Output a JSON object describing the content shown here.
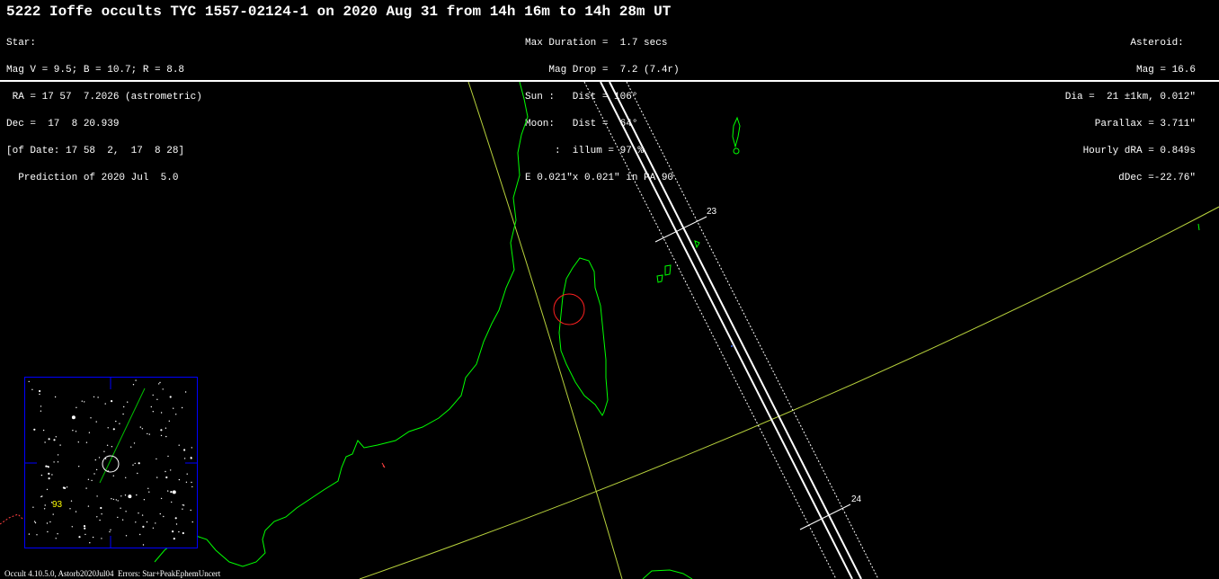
{
  "header": {
    "title": "5222 Ioffe occults TYC 1557-02124-1 on 2020 Aug 31 from 14h 16m to 14h 28m UT"
  },
  "star": {
    "lines": [
      "Star:",
      "Mag V = 9.5; B = 10.7; R = 8.8",
      " RA = 17 57  7.2026 (astrometric)",
      "Dec =  17  8 20.939",
      "[of Date: 17 58  2,  17  8 28]",
      "  Prediction of 2020 Jul  5.0"
    ]
  },
  "event": {
    "lines": [
      "Max Duration =  1.7 secs",
      "    Mag Drop =  7.2 (7.4r)",
      "Sun :   Dist = 106°",
      "Moon:   Dist =  64°",
      "     :  illum = 97 %",
      "E 0.021\"x 0.021\" in PA 90"
    ]
  },
  "asteroid": {
    "lines": [
      "Asteroid:  ",
      "Mag = 16.6",
      "Dia =  21 ±1km, 0.012\"",
      "Parallax = 3.711\"",
      "Hourly dRA = 0.849s",
      "dDec =-22.76\""
    ]
  },
  "map": {
    "time_labels": [
      "23",
      "24"
    ],
    "colors": {
      "coastline": "#00ff00",
      "graticule": "#b8d23c",
      "path": "#ffffff",
      "target": "#ff2020",
      "inset_frame": "#0000ff",
      "inset_label": "#ffff00"
    }
  },
  "inset": {
    "label": "93"
  },
  "footer": {
    "text": "Occult 4.10.5.0, Astorb2020Jul04  Errors: Star+PeakEphemUncert"
  }
}
